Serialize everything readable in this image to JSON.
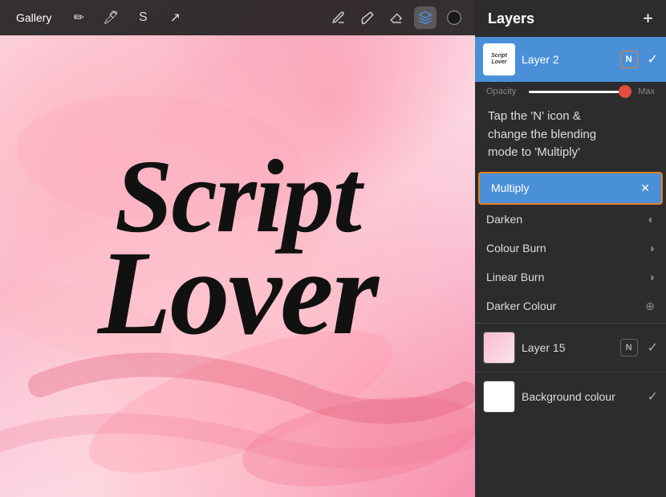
{
  "toolbar": {
    "gallery_label": "Gallery",
    "add_label": "+",
    "tools": [
      "✏️",
      "✒️",
      "◇",
      "□",
      "●"
    ]
  },
  "layers_panel": {
    "title": "Layers",
    "add_button": "+",
    "layer2": {
      "name": "Layer 2",
      "badge": "N",
      "thumb_text": "Script\nLover"
    },
    "opacity": {
      "label": "Opacity",
      "max_label": "Max",
      "value": 100
    },
    "instruction": "Tap the 'N' icon &\nchange the blending\nmode to 'Multiply'",
    "blending_modes": [
      {
        "name": "Multiply",
        "selected": true,
        "icon": "✕"
      },
      {
        "name": "Darken",
        "selected": false,
        "icon": "◐"
      },
      {
        "name": "Colour Burn",
        "selected": false,
        "icon": "◑"
      },
      {
        "name": "Linear Burn",
        "selected": false,
        "icon": "◑"
      },
      {
        "name": "Darker Colour",
        "selected": false,
        "icon": "+"
      }
    ],
    "layer15": {
      "name": "Layer 15",
      "badge": "N"
    },
    "bg_colour": {
      "name": "Background colour"
    }
  },
  "canvas": {
    "script_line1": "Script",
    "script_line2": "Lover"
  }
}
